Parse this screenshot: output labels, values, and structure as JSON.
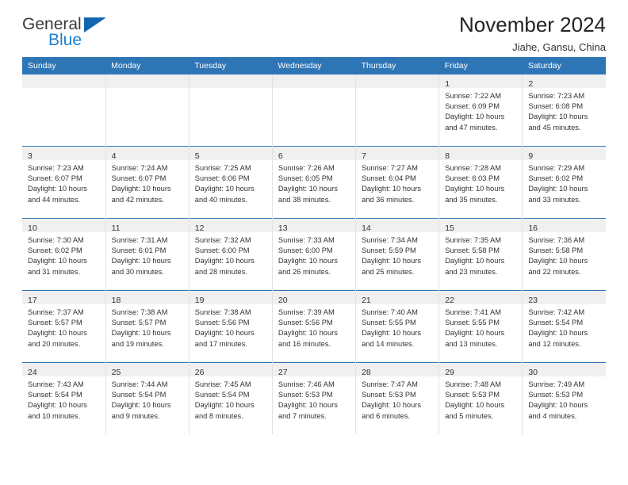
{
  "brand": {
    "name_part1": "General",
    "name_part2": "Blue",
    "triangle_color": "#1267b0",
    "blue_color": "#1c7fd0"
  },
  "header": {
    "title": "November 2024",
    "subtitle": "Jiahe, Gansu, China"
  },
  "colors": {
    "header_row": "#2e75b6",
    "daynum_band": "#f0f0f0",
    "text": "#333333"
  },
  "weekdays": [
    "Sunday",
    "Monday",
    "Tuesday",
    "Wednesday",
    "Thursday",
    "Friday",
    "Saturday"
  ],
  "weeks": [
    [
      {
        "empty": true
      },
      {
        "empty": true
      },
      {
        "empty": true
      },
      {
        "empty": true
      },
      {
        "empty": true
      },
      {
        "day": "1",
        "l1": "Sunrise: 7:22 AM",
        "l2": "Sunset: 6:09 PM",
        "l3": "Daylight: 10 hours",
        "l4": "and 47 minutes."
      },
      {
        "day": "2",
        "l1": "Sunrise: 7:23 AM",
        "l2": "Sunset: 6:08 PM",
        "l3": "Daylight: 10 hours",
        "l4": "and 45 minutes."
      }
    ],
    [
      {
        "day": "3",
        "l1": "Sunrise: 7:23 AM",
        "l2": "Sunset: 6:07 PM",
        "l3": "Daylight: 10 hours",
        "l4": "and 44 minutes."
      },
      {
        "day": "4",
        "l1": "Sunrise: 7:24 AM",
        "l2": "Sunset: 6:07 PM",
        "l3": "Daylight: 10 hours",
        "l4": "and 42 minutes."
      },
      {
        "day": "5",
        "l1": "Sunrise: 7:25 AM",
        "l2": "Sunset: 6:06 PM",
        "l3": "Daylight: 10 hours",
        "l4": "and 40 minutes."
      },
      {
        "day": "6",
        "l1": "Sunrise: 7:26 AM",
        "l2": "Sunset: 6:05 PM",
        "l3": "Daylight: 10 hours",
        "l4": "and 38 minutes."
      },
      {
        "day": "7",
        "l1": "Sunrise: 7:27 AM",
        "l2": "Sunset: 6:04 PM",
        "l3": "Daylight: 10 hours",
        "l4": "and 36 minutes."
      },
      {
        "day": "8",
        "l1": "Sunrise: 7:28 AM",
        "l2": "Sunset: 6:03 PM",
        "l3": "Daylight: 10 hours",
        "l4": "and 35 minutes."
      },
      {
        "day": "9",
        "l1": "Sunrise: 7:29 AM",
        "l2": "Sunset: 6:02 PM",
        "l3": "Daylight: 10 hours",
        "l4": "and 33 minutes."
      }
    ],
    [
      {
        "day": "10",
        "l1": "Sunrise: 7:30 AM",
        "l2": "Sunset: 6:02 PM",
        "l3": "Daylight: 10 hours",
        "l4": "and 31 minutes."
      },
      {
        "day": "11",
        "l1": "Sunrise: 7:31 AM",
        "l2": "Sunset: 6:01 PM",
        "l3": "Daylight: 10 hours",
        "l4": "and 30 minutes."
      },
      {
        "day": "12",
        "l1": "Sunrise: 7:32 AM",
        "l2": "Sunset: 6:00 PM",
        "l3": "Daylight: 10 hours",
        "l4": "and 28 minutes."
      },
      {
        "day": "13",
        "l1": "Sunrise: 7:33 AM",
        "l2": "Sunset: 6:00 PM",
        "l3": "Daylight: 10 hours",
        "l4": "and 26 minutes."
      },
      {
        "day": "14",
        "l1": "Sunrise: 7:34 AM",
        "l2": "Sunset: 5:59 PM",
        "l3": "Daylight: 10 hours",
        "l4": "and 25 minutes."
      },
      {
        "day": "15",
        "l1": "Sunrise: 7:35 AM",
        "l2": "Sunset: 5:58 PM",
        "l3": "Daylight: 10 hours",
        "l4": "and 23 minutes."
      },
      {
        "day": "16",
        "l1": "Sunrise: 7:36 AM",
        "l2": "Sunset: 5:58 PM",
        "l3": "Daylight: 10 hours",
        "l4": "and 22 minutes."
      }
    ],
    [
      {
        "day": "17",
        "l1": "Sunrise: 7:37 AM",
        "l2": "Sunset: 5:57 PM",
        "l3": "Daylight: 10 hours",
        "l4": "and 20 minutes."
      },
      {
        "day": "18",
        "l1": "Sunrise: 7:38 AM",
        "l2": "Sunset: 5:57 PM",
        "l3": "Daylight: 10 hours",
        "l4": "and 19 minutes."
      },
      {
        "day": "19",
        "l1": "Sunrise: 7:38 AM",
        "l2": "Sunset: 5:56 PM",
        "l3": "Daylight: 10 hours",
        "l4": "and 17 minutes."
      },
      {
        "day": "20",
        "l1": "Sunrise: 7:39 AM",
        "l2": "Sunset: 5:56 PM",
        "l3": "Daylight: 10 hours",
        "l4": "and 16 minutes."
      },
      {
        "day": "21",
        "l1": "Sunrise: 7:40 AM",
        "l2": "Sunset: 5:55 PM",
        "l3": "Daylight: 10 hours",
        "l4": "and 14 minutes."
      },
      {
        "day": "22",
        "l1": "Sunrise: 7:41 AM",
        "l2": "Sunset: 5:55 PM",
        "l3": "Daylight: 10 hours",
        "l4": "and 13 minutes."
      },
      {
        "day": "23",
        "l1": "Sunrise: 7:42 AM",
        "l2": "Sunset: 5:54 PM",
        "l3": "Daylight: 10 hours",
        "l4": "and 12 minutes."
      }
    ],
    [
      {
        "day": "24",
        "l1": "Sunrise: 7:43 AM",
        "l2": "Sunset: 5:54 PM",
        "l3": "Daylight: 10 hours",
        "l4": "and 10 minutes."
      },
      {
        "day": "25",
        "l1": "Sunrise: 7:44 AM",
        "l2": "Sunset: 5:54 PM",
        "l3": "Daylight: 10 hours",
        "l4": "and 9 minutes."
      },
      {
        "day": "26",
        "l1": "Sunrise: 7:45 AM",
        "l2": "Sunset: 5:54 PM",
        "l3": "Daylight: 10 hours",
        "l4": "and 8 minutes."
      },
      {
        "day": "27",
        "l1": "Sunrise: 7:46 AM",
        "l2": "Sunset: 5:53 PM",
        "l3": "Daylight: 10 hours",
        "l4": "and 7 minutes."
      },
      {
        "day": "28",
        "l1": "Sunrise: 7:47 AM",
        "l2": "Sunset: 5:53 PM",
        "l3": "Daylight: 10 hours",
        "l4": "and 6 minutes."
      },
      {
        "day": "29",
        "l1": "Sunrise: 7:48 AM",
        "l2": "Sunset: 5:53 PM",
        "l3": "Daylight: 10 hours",
        "l4": "and 5 minutes."
      },
      {
        "day": "30",
        "l1": "Sunrise: 7:49 AM",
        "l2": "Sunset: 5:53 PM",
        "l3": "Daylight: 10 hours",
        "l4": "and 4 minutes."
      }
    ]
  ]
}
